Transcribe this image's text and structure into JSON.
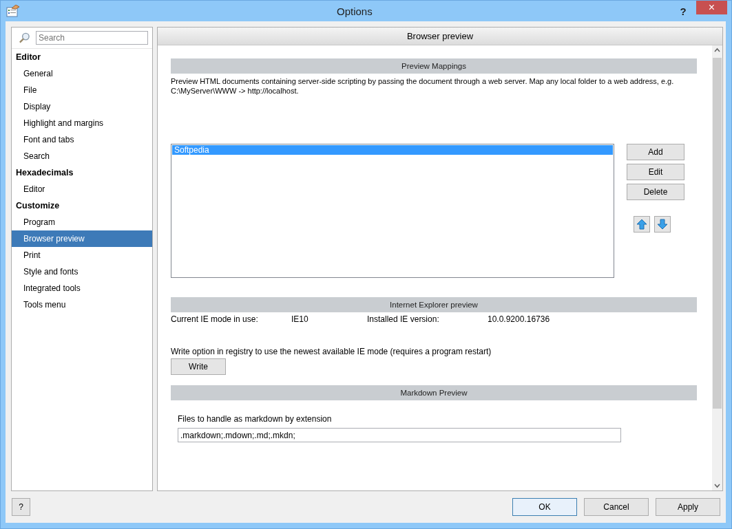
{
  "window": {
    "title": "Options",
    "help": "?",
    "close": "×"
  },
  "search": {
    "placeholder": "Search"
  },
  "sidebar": {
    "groups": [
      {
        "label": "Editor",
        "children": [
          {
            "label": "General",
            "selected": false
          },
          {
            "label": "File",
            "selected": false
          },
          {
            "label": "Display",
            "selected": false
          },
          {
            "label": "Highlight and margins",
            "selected": false
          },
          {
            "label": "Font and tabs",
            "selected": false
          },
          {
            "label": "Search",
            "selected": false
          }
        ]
      },
      {
        "label": "Hexadecimals",
        "children": [
          {
            "label": "Editor",
            "selected": false
          }
        ]
      },
      {
        "label": "Customize",
        "children": [
          {
            "label": "Program",
            "selected": false
          },
          {
            "label": "Browser preview",
            "selected": true
          },
          {
            "label": "Print",
            "selected": false
          },
          {
            "label": "Style and fonts",
            "selected": false
          },
          {
            "label": "Integrated tools",
            "selected": false
          },
          {
            "label": "Tools menu",
            "selected": false
          }
        ]
      }
    ]
  },
  "panel": {
    "title": "Browser preview",
    "mappings": {
      "heading": "Preview Mappings",
      "description": "Preview HTML documents containing server-side scripting by passing the document through a web server. Map any local folder to a web address, e.g. C:\\MyServer\\WWW -> http://localhost.",
      "items": [
        {
          "label": "Softpedia",
          "selected": true
        }
      ],
      "buttons": [
        "Add",
        "Edit",
        "Delete"
      ]
    },
    "ie": {
      "heading": "Internet Explorer preview",
      "mode_label": "Current IE mode in use:",
      "mode_value": "IE10",
      "version_label": "Installed IE version:",
      "version_value": "10.0.9200.16736",
      "write_note": "Write option in registry to use the newest available IE mode (requires a program restart)",
      "write_button": "Write"
    },
    "markdown": {
      "heading": "Markdown Preview",
      "label": "Files to handle as markdown by extension",
      "value": ".markdown;.mdown;.md;.mkdn;"
    }
  },
  "footer": {
    "help": "?",
    "buttons": [
      {
        "label": "OK",
        "default": true
      },
      {
        "label": "Cancel",
        "default": false
      },
      {
        "label": "Apply",
        "default": false
      }
    ]
  }
}
